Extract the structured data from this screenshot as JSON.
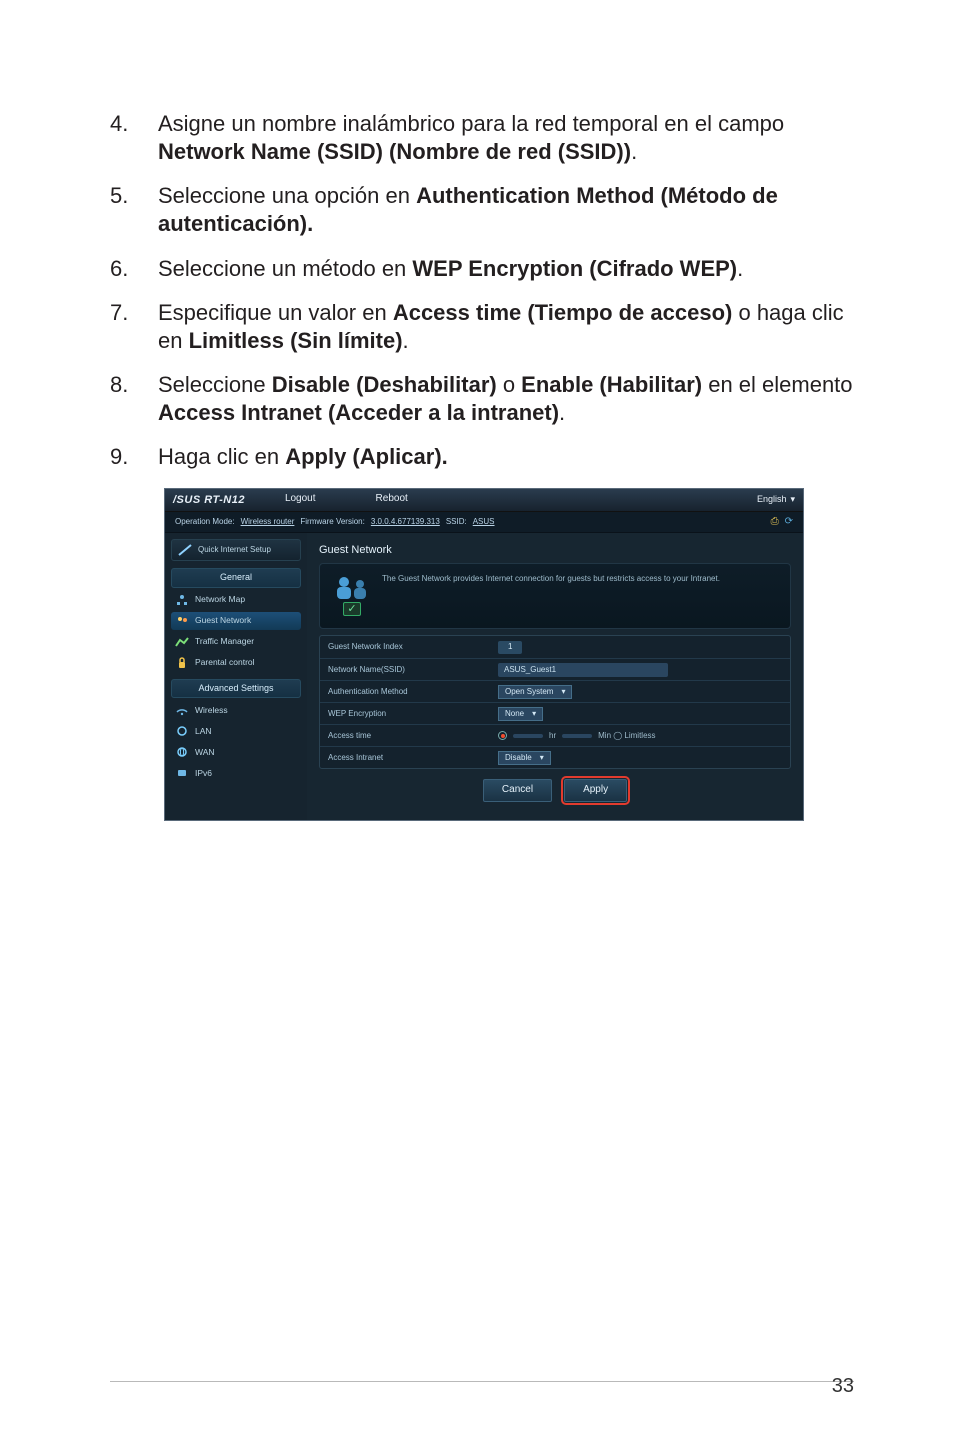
{
  "steps": [
    {
      "n": "4.",
      "pre": "Asigne un nombre inalámbrico para la red temporal en el campo ",
      "b": "Network Name (SSID) (Nombre de red (SSID))",
      "post": "."
    },
    {
      "n": "5.",
      "pre": "Seleccione una opción en ",
      "b": "Authentication Method (Método de autenticación).",
      "post": ""
    },
    {
      "n": "6.",
      "pre": "Seleccione un método en ",
      "b": "WEP Encryption (Cifrado WEP)",
      "post": "."
    },
    {
      "n": "7.",
      "pre": "Especifique un valor en ",
      "b": "Access time (Tiempo de acceso)",
      "mid": " o haga clic en ",
      "b2": "Limitless (Sin límite)",
      "post": "."
    },
    {
      "n": "8.",
      "pre": "Seleccione ",
      "b": "Disable (Deshabilitar)",
      "mid": " o ",
      "b2": "Enable (Habilitar)",
      "post2": " en el elemento ",
      "b3": "Access Intranet (Acceder a la intranet)",
      "post": "."
    },
    {
      "n": "9.",
      "pre": "Haga clic en ",
      "b": "Apply (Aplicar).",
      "post": ""
    }
  ],
  "shot": {
    "brand_model": "RT-N12",
    "logout": "Logout",
    "reboot": "Reboot",
    "lang": "English",
    "meta": {
      "op_lbl": "Operation Mode:",
      "op_val": "Wireless router",
      "fw_lbl": "Firmware Version:",
      "fw_val": "3.0.0.4.677139.313",
      "ssid_lbl": "SSID:",
      "ssid_val": "ASUS"
    },
    "sidebar": {
      "qis": "Quick Internet Setup",
      "general": "General",
      "items_general": [
        {
          "icon": "network-map-icon",
          "label": "Network Map"
        },
        {
          "icon": "guest-network-icon",
          "label": "Guest Network",
          "active": true
        },
        {
          "icon": "traffic-manager-icon",
          "label": "Traffic Manager"
        },
        {
          "icon": "parental-control-icon",
          "label": "Parental control"
        }
      ],
      "advanced": "Advanced Settings",
      "items_adv": [
        {
          "icon": "wireless-icon",
          "label": "Wireless"
        },
        {
          "icon": "lan-icon",
          "label": "LAN"
        },
        {
          "icon": "wan-icon",
          "label": "WAN"
        },
        {
          "icon": "ipv6-icon",
          "label": "IPv6"
        }
      ]
    },
    "panel_title": "Guest Network",
    "hero_text": "The Guest Network provides Internet connection for guests but restricts access to your Intranet.",
    "rows": {
      "idx_lbl": "Guest Network Index",
      "idx_val": "1",
      "ssid_lbl": "Network Name(SSID)",
      "ssid_val": "ASUS_Guest1",
      "auth_lbl": "Authentication Method",
      "auth_val": "Open System",
      "wep_lbl": "WEP Encryption",
      "wep_val": "None",
      "time_lbl": "Access time",
      "time_hr": "hr",
      "time_limitless": "Min  ◯ Limitless",
      "intr_lbl": "Access Intranet",
      "intr_val": "Disable"
    },
    "btn_cancel": "Cancel",
    "btn_apply": "Apply"
  },
  "page_number": "33"
}
